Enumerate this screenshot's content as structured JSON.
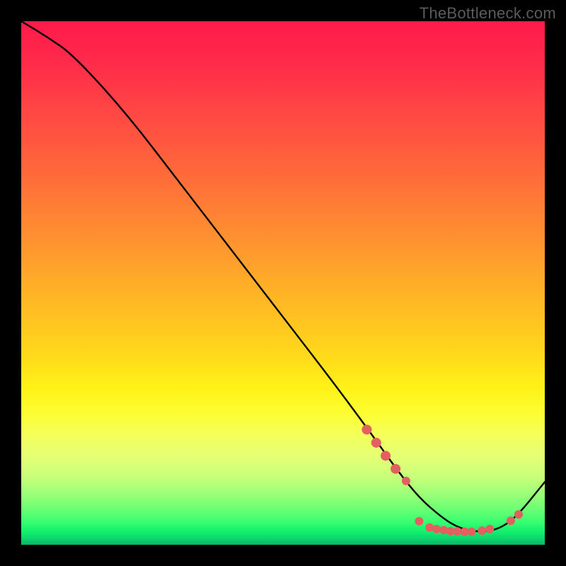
{
  "watermark": "TheBottleneck.com",
  "chart_data": {
    "type": "line",
    "title": "",
    "xlabel": "",
    "ylabel": "",
    "xlim": [
      0,
      100
    ],
    "ylim": [
      0,
      100
    ],
    "grid": false,
    "series": [
      {
        "name": "curve",
        "color": "#000000",
        "x": [
          0,
          5,
          10,
          20,
          30,
          40,
          50,
          60,
          67,
          72,
          76,
          80,
          83,
          86,
          89,
          92,
          95,
          100
        ],
        "values": [
          100,
          97,
          93.5,
          82.5,
          69.5,
          56.5,
          43.5,
          30.5,
          21,
          14,
          9,
          5.5,
          3.5,
          2.6,
          2.5,
          3.4,
          5.8,
          12
        ]
      }
    ],
    "markers": [
      {
        "x": 66.0,
        "y": 22.0,
        "color": "#e36060",
        "r": 7
      },
      {
        "x": 67.8,
        "y": 19.5,
        "color": "#e36060",
        "r": 7
      },
      {
        "x": 69.6,
        "y": 17.0,
        "color": "#e36060",
        "r": 7
      },
      {
        "x": 71.5,
        "y": 14.5,
        "color": "#e36060",
        "r": 7
      },
      {
        "x": 73.5,
        "y": 12.2,
        "color": "#e36060",
        "r": 6
      },
      {
        "x": 76.0,
        "y": 4.5,
        "color": "#e36060",
        "r": 6
      },
      {
        "x": 78.0,
        "y": 3.3,
        "color": "#e36060",
        "r": 6
      },
      {
        "x": 79.3,
        "y": 3.0,
        "color": "#e36060",
        "r": 6
      },
      {
        "x": 80.7,
        "y": 2.8,
        "color": "#e36060",
        "r": 6
      },
      {
        "x": 82.0,
        "y": 2.6,
        "color": "#e36060",
        "r": 6
      },
      {
        "x": 83.3,
        "y": 2.55,
        "color": "#e36060",
        "r": 6
      },
      {
        "x": 84.7,
        "y": 2.5,
        "color": "#e36060",
        "r": 6
      },
      {
        "x": 86.0,
        "y": 2.5,
        "color": "#e36060",
        "r": 6
      },
      {
        "x": 88.0,
        "y": 2.7,
        "color": "#e36060",
        "r": 6
      },
      {
        "x": 89.5,
        "y": 3.0,
        "color": "#e36060",
        "r": 6
      },
      {
        "x": 93.5,
        "y": 4.6,
        "color": "#e36060",
        "r": 6
      },
      {
        "x": 95.0,
        "y": 5.8,
        "color": "#e36060",
        "r": 6
      }
    ]
  }
}
